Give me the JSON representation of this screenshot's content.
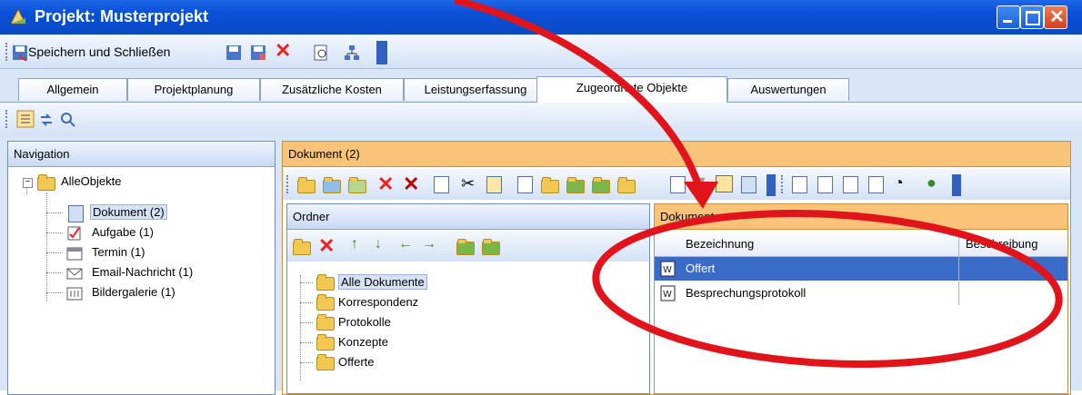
{
  "window": {
    "title": "Projekt: Musterprojekt"
  },
  "toolbar": {
    "save_close": "Speichern und Schließen"
  },
  "tabs": [
    "Allgemein",
    "Projektplanung",
    "Zusätzliche Kosten",
    "Leistungserfassung",
    "Zugeordnete Objekte",
    "Auswertungen"
  ],
  "active_tab": "Zugeordnete Objekte",
  "navigation": {
    "title": "Navigation",
    "root": "AlleObjekte",
    "items": [
      "Dokument (2)",
      "Aufgabe (1)",
      "Termin (1)",
      "Email-Nachricht (1)",
      "Bildergalerie (1)"
    ]
  },
  "document_panel": {
    "title": "Dokument (2)"
  },
  "ordner": {
    "title": "Ordner",
    "folders": [
      "Alle Dokumente",
      "Korrespondenz",
      "Protokolle",
      "Konzepte",
      "Offerte"
    ]
  },
  "dokumente": {
    "title": "Dokumente",
    "columns": [
      "Bezeichnung",
      "Beschreibung"
    ],
    "rows": [
      {
        "bezeichnung": "Offert",
        "beschreibung": ""
      },
      {
        "bezeichnung": "Besprechungsprotokoll",
        "beschreibung": ""
      }
    ]
  },
  "colors": {
    "annotation": "#e0141a",
    "panel_header": "#f9c479",
    "selection": "#3b6bc9"
  },
  "annotation": {
    "shape": "red-ellipse-and-arrow",
    "target": "Offert row"
  }
}
